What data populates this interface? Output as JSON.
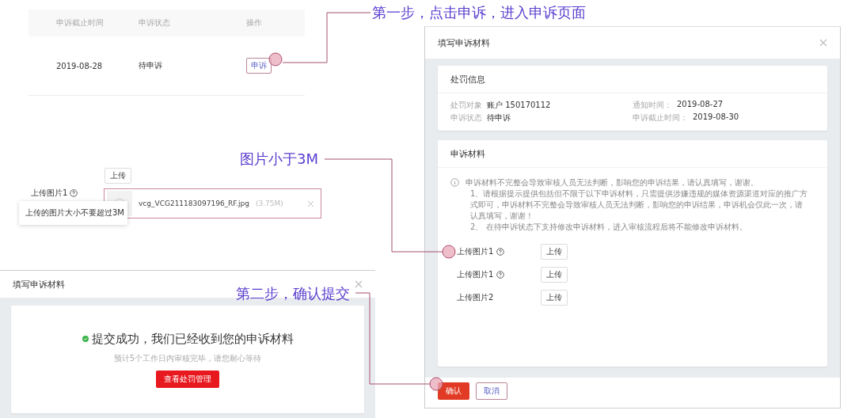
{
  "annotations": [
    {
      "text": "第一步，点击申诉，进入申诉页面"
    },
    {
      "text": "图片小于3M"
    },
    {
      "text": "第二步，确认提交"
    }
  ],
  "appeal_table": {
    "columns": [
      "申诉截止时间",
      "申诉状态",
      "操作"
    ],
    "rows": [
      {
        "cells": [
          "2019-08-28",
          "待申诉"
        ],
        "action": "申诉"
      }
    ]
  },
  "upload_error": {
    "upload_button": "上传",
    "label": "上传图片1",
    "help": true,
    "file": {
      "name": "vcg_VCG211183097196_RF.jpg",
      "size": "(3.75M)"
    },
    "tooltip": "上传的图片大小不要超过3M"
  },
  "success_dialog": {
    "title": "填写申诉材料",
    "message": "提交成功，我们已经收到您的申诉材料",
    "note": "预计5个工作日内审核完毕，请您耐心等待",
    "button": "查看处罚管理"
  },
  "appeal_dialog": {
    "title": "填写申诉材料",
    "penalty_card": {
      "title": "处罚信息",
      "fields": [
        {
          "label": "处罚对象",
          "value": "账户 150170112"
        },
        {
          "label": "通知时间：",
          "value": "2019-08-27"
        },
        {
          "label": "申诉状态",
          "value": "待申诉"
        },
        {
          "label": "申诉截止时间：",
          "value": "2019-08-30"
        }
      ]
    },
    "materials_card": {
      "title": "申诉材料",
      "notice": [
        "申诉材料不完整会导致审核人员无法判断，影响您的申诉结果，请认真填写，谢谢。",
        "1、请根据提示提供包括但不限于以下申诉材料，只需提供涉嫌违规的媒体资源渠道对应的推广方式即可，申诉材料不完整会导致审核人员无法判断，影响您的申诉结果，申诉机会仅此一次，请认真填写，谢谢！",
        "2、 在待申诉状态下支持修改申诉材料，进入审核流程后将不能修改申诉材料。"
      ],
      "uploads": [
        {
          "label": "上传图片1",
          "help": true,
          "button": "上传"
        },
        {
          "label": "上传图片1",
          "help": true,
          "button": "上传"
        },
        {
          "label": "上传图片2",
          "help": false,
          "button": "上传"
        }
      ]
    },
    "buttons": [
      {
        "label": "确认",
        "kind": "primary"
      },
      {
        "label": "取消",
        "kind": "secondary"
      }
    ]
  }
}
